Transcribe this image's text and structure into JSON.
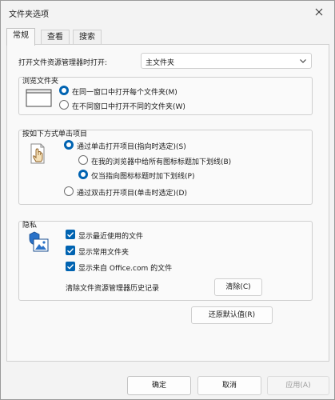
{
  "window": {
    "title": "文件夹选项"
  },
  "tabs": [
    {
      "label": "常规"
    },
    {
      "label": "查看"
    },
    {
      "label": "搜索"
    }
  ],
  "general": {
    "open_explorer_label": "打开文件资源管理器时打开:",
    "open_explorer_value": "主文件夹",
    "browse": {
      "title": "浏览文件夹",
      "options": [
        {
          "label": "在同一窗口中打开每个文件夹(M)",
          "selected": true
        },
        {
          "label": "在不同窗口中打开不同的文件夹(W)",
          "selected": false
        }
      ]
    },
    "click": {
      "title": "按如下方式单击项目",
      "single_click": {
        "label": "通过单击打开项目(指向时选定)(S)",
        "selected": true
      },
      "underline_options": [
        {
          "label": "在我的浏览器中给所有图标标题加下划线(B)",
          "selected": false
        },
        {
          "label": "仅当指向图标标题时加下划线(P)",
          "selected": true
        }
      ],
      "double_click": {
        "label": "通过双击打开项目(单击时选定)(D)",
        "selected": false
      }
    },
    "privacy": {
      "title": "隐私",
      "checks": [
        {
          "label": "显示最近使用的文件",
          "checked": true
        },
        {
          "label": "显示常用文件夹",
          "checked": true
        },
        {
          "label": "显示来自 Office.com 的文件",
          "checked": true
        }
      ],
      "clear_label": "清除文件资源管理器历史记录",
      "clear_button": "清除(C)"
    },
    "restore_button": "还原默认值(R)"
  },
  "footer": {
    "ok": "确定",
    "cancel": "取消",
    "apply": "应用(A)"
  },
  "colors": {
    "accent": "#0063b1"
  }
}
